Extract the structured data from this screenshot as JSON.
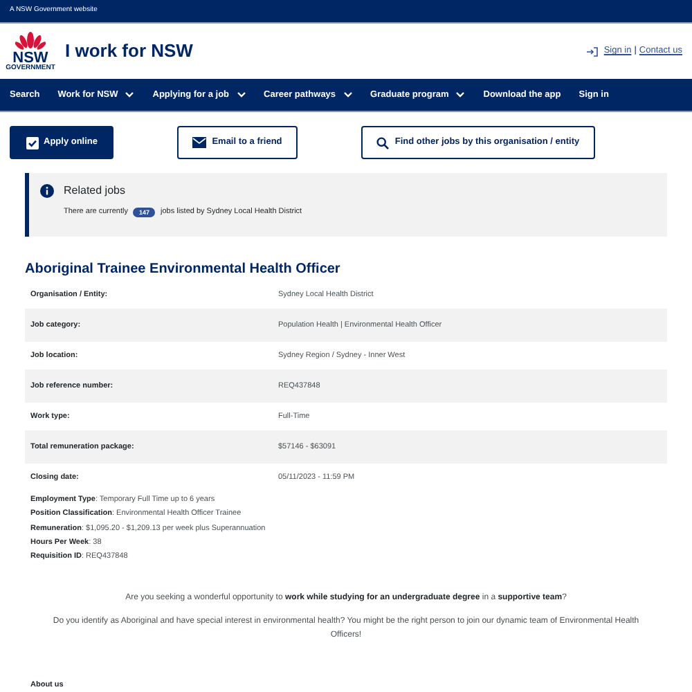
{
  "masthead": {
    "text": "A NSW Government website"
  },
  "header": {
    "logo_text": "NSW",
    "logo_subtext": "GOVERNMENT",
    "site_title": "I work for NSW",
    "links": [
      "Sign in",
      "Contact us"
    ],
    "separator": "|"
  },
  "nav": [
    {
      "label": "Search",
      "has_menu": false
    },
    {
      "label": "Work for NSW",
      "has_menu": true
    },
    {
      "label": "Applying for a job",
      "has_menu": true
    },
    {
      "label": "Career pathways",
      "has_menu": true
    },
    {
      "label": "Graduate program",
      "has_menu": true
    },
    {
      "label": "Download the app",
      "has_menu": false
    },
    {
      "label": "Sign in",
      "has_menu": false
    }
  ],
  "actions": [
    {
      "label": "Apply online",
      "kind": "primary"
    },
    {
      "label": "Email to a friend",
      "kind": "email"
    },
    {
      "label": "Find other jobs by this organisation / entity",
      "kind": "search"
    }
  ],
  "related": {
    "title": "Related jobs",
    "before": "There are currently",
    "count": "147",
    "after": "jobs listed by Sydney Local Health District"
  },
  "job_title": "Aboriginal Trainee Environmental Health Officer",
  "details": [
    {
      "label": "Organisation / Entity:",
      "value": "Sydney Local Health District"
    },
    {
      "label": "Job category:",
      "value": "Population Health | Environmental Health Officer"
    },
    {
      "label": "Job location:",
      "value": "Sydney Region / Sydney - Inner West"
    },
    {
      "label": "Job reference number:",
      "value": "REQ437848"
    },
    {
      "label": "Work type:",
      "value": "Full-Time"
    },
    {
      "label": "Total remuneration package:",
      "value": "$57146 - $63091"
    },
    {
      "label": "Closing date:",
      "value": "05/11/2023 - 11:59 PM"
    }
  ],
  "summary": [
    "**Employment Type**: Temporary Full Time up to 6 years",
    "**Position Classification**: Environmental Health Officer Trainee",
    "**Remuneration**: $1,095.20 - $1,209.13 per week plus Superannuation",
    "**Hours Per Week**: 38",
    "**Requisition ID**: REQ437848"
  ],
  "intro": [
    "Are you seeking a wonderful opportunity to **work while studying for an undergraduate degree** in a **supportive team**?",
    "Do you identify as Aboriginal and have special interest in environmental health? You might be the right person to join our dynamic team of Environmental Health Officers!"
  ],
  "section_heading": "About us"
}
